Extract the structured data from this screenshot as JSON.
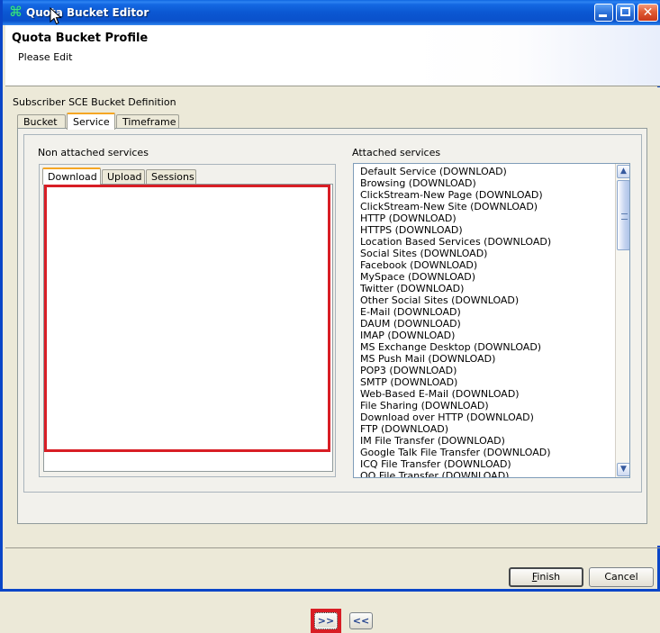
{
  "window": {
    "title": "Quota Bucket Editor",
    "icon": "app-icon",
    "controls": {
      "minimize": "minimize-icon",
      "maximize": "maximize-icon",
      "close": "close-icon"
    }
  },
  "header": {
    "title": "Quota Bucket Profile",
    "subtitle": "Please Edit"
  },
  "section": {
    "label": "Subscriber SCE Bucket Definition"
  },
  "outer_tabs": [
    {
      "label": "Bucket",
      "active": false
    },
    {
      "label": "Service",
      "active": true
    },
    {
      "label": "Timeframe",
      "active": false
    }
  ],
  "non_attached": {
    "label": "Non attached services",
    "tabs": [
      {
        "label": "Download",
        "active": true
      },
      {
        "label": "Upload",
        "active": false
      },
      {
        "label": "Sessions",
        "active": false
      }
    ],
    "items": []
  },
  "attached": {
    "label": "Attached services",
    "items": [
      "Default Service (DOWNLOAD)",
      "Browsing (DOWNLOAD)",
      "ClickStream-New Page (DOWNLOAD)",
      "ClickStream-New Site (DOWNLOAD)",
      "HTTP (DOWNLOAD)",
      "HTTPS (DOWNLOAD)",
      "Location Based Services (DOWNLOAD)",
      "Social Sites (DOWNLOAD)",
      "Facebook (DOWNLOAD)",
      "MySpace (DOWNLOAD)",
      "Twitter (DOWNLOAD)",
      "Other Social Sites (DOWNLOAD)",
      "E-Mail (DOWNLOAD)",
      "DAUM (DOWNLOAD)",
      "IMAP (DOWNLOAD)",
      "MS Exchange Desktop (DOWNLOAD)",
      "MS Push Mail (DOWNLOAD)",
      "POP3 (DOWNLOAD)",
      "SMTP (DOWNLOAD)",
      "Web-Based E-Mail (DOWNLOAD)",
      "File Sharing (DOWNLOAD)",
      "Download over HTTP (DOWNLOAD)",
      "FTP (DOWNLOAD)",
      "IM File Transfer (DOWNLOAD)",
      "Google Talk File Transfer (DOWNLOAD)",
      "ICQ File Transfer (DOWNLOAD)",
      "QQ File Transfer (DOWNLOAD)"
    ],
    "scrollbar": {
      "up": "scroll-up-icon",
      "down": "scroll-down-icon"
    }
  },
  "transfer": {
    "attach_label": ">>",
    "detach_label": "<<"
  },
  "footer": {
    "finish_label": "Finish",
    "finish_accel": "F",
    "finish_rest": "inish",
    "cancel_label": "Cancel"
  },
  "colors": {
    "highlight": "#D81E25",
    "titlebar": "#0B57D2",
    "tab_active_accent": "#F5A623",
    "body_bg": "#ECE9D8"
  }
}
